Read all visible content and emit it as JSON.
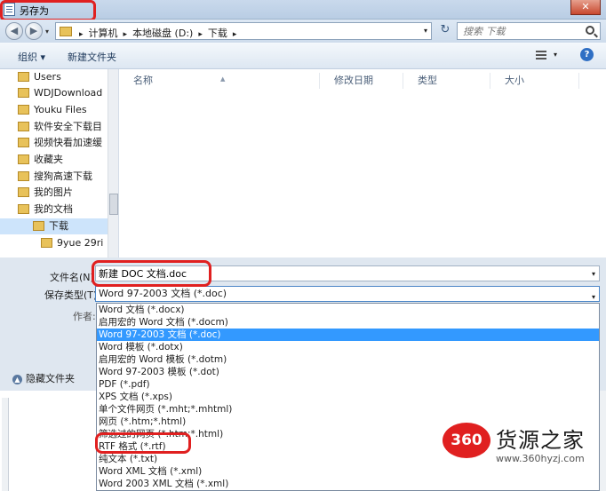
{
  "window": {
    "title": "另存为",
    "close_glyph": "✕"
  },
  "address": {
    "crumbs": [
      "计算机",
      "本地磁盘 (D:)",
      "下载"
    ],
    "search_placeholder": "搜索 下载"
  },
  "toolbar": {
    "organize_label": "组织 ▾",
    "new_folder_label": "新建文件夹",
    "help_glyph": "?"
  },
  "nav_pane": {
    "items": [
      {
        "label": "Users",
        "icon": "folder-icon"
      },
      {
        "label": "WDJDownload",
        "icon": "folder-icon"
      },
      {
        "label": "Youku Files",
        "icon": "folder-icon"
      },
      {
        "label": "软件安全下载目",
        "icon": "folder-icon"
      },
      {
        "label": "视频快看加速缓",
        "icon": "folder-icon"
      },
      {
        "label": "收藏夹",
        "icon": "folder-icon"
      },
      {
        "label": "搜狗高速下载",
        "icon": "folder-icon"
      },
      {
        "label": "我的图片",
        "icon": "folder-icon"
      },
      {
        "label": "我的文档",
        "icon": "folder-icon"
      },
      {
        "label": "下载",
        "icon": "download-folder-icon",
        "selected": true
      },
      {
        "label": "9yue 29ri",
        "icon": "folder-icon",
        "sub": true
      }
    ]
  },
  "file_list": {
    "columns": [
      "名称",
      "修改日期",
      "类型",
      "大小"
    ]
  },
  "form": {
    "filename_label": "文件名(N):",
    "filename_value": "新建 DOC 文档.doc",
    "savetype_label": "保存类型(T):",
    "savetype_value": "Word 97-2003 文档 (*.doc)",
    "author_label": "作者:",
    "hide_folders_label": "隐藏文件夹"
  },
  "save_type_options": [
    "Word 文档 (*.docx)",
    "启用宏的 Word 文档 (*.docm)",
    "Word 97-2003 文档 (*.doc)",
    "Word 模板 (*.dotx)",
    "启用宏的 Word 模板 (*.dotm)",
    "Word 97-2003 模板 (*.dot)",
    "PDF (*.pdf)",
    "XPS 文档 (*.xps)",
    "单个文件网页 (*.mht;*.mhtml)",
    "网页 (*.htm;*.html)",
    "筛选过的网页 (*.htm;*.html)",
    "RTF 格式 (*.rtf)",
    "纯文本 (*.txt)",
    "Word XML 文档 (*.xml)",
    "Word 2003 XML 文档 (*.xml)"
  ],
  "selected_option_index": 2,
  "watermark": {
    "badge": "360",
    "brand": "货源之家",
    "url": "www.360hyzj.com"
  },
  "colors": {
    "highlight": "#e02020",
    "selection": "#3399ff"
  }
}
